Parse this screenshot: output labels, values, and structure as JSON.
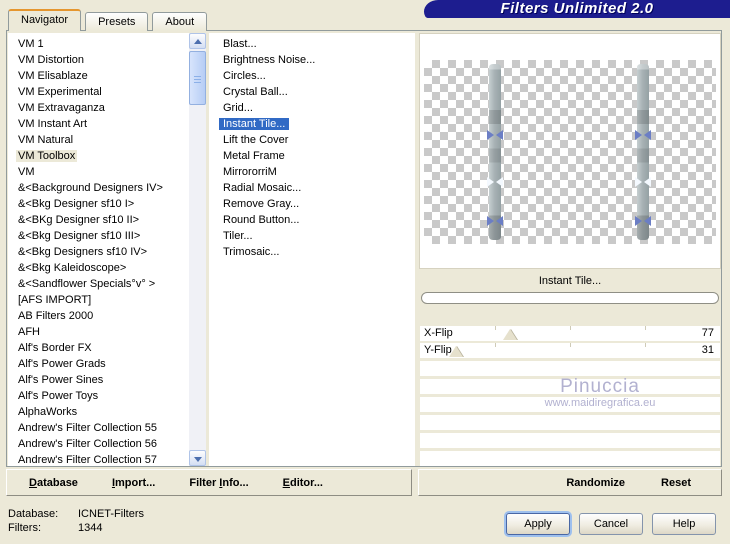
{
  "window": {
    "title": "Filters Unlimited 2.0"
  },
  "tabs": {
    "items": [
      {
        "label": "Navigator",
        "selected": true
      },
      {
        "label": "Presets"
      },
      {
        "label": "About"
      }
    ]
  },
  "categories": {
    "selected_index": 7,
    "items": [
      "VM 1",
      "VM Distortion",
      "VM Elisablaze",
      "VM Experimental",
      "VM Extravaganza",
      "VM Instant Art",
      "VM Natural",
      "VM Toolbox",
      "VM",
      "&<Background Designers IV>",
      "&<Bkg Designer sf10 I>",
      "&<BKg Designer sf10 II>",
      "&<Bkg Designer sf10 III>",
      "&<Bkg Designers sf10 IV>",
      "&<Bkg Kaleidoscope>",
      "&<Sandflower Specials°v° >",
      "[AFS IMPORT]",
      "AB Filters 2000",
      "AFH",
      "Alf's Border FX",
      "Alf's Power Grads",
      "Alf's Power Sines",
      "Alf's Power Toys",
      "AlphaWorks",
      "Andrew's Filter Collection 55",
      "Andrew's Filter Collection 56",
      "Andrew's Filter Collection 57"
    ]
  },
  "filters": {
    "selected_index": 5,
    "items": [
      "Blast...",
      "Brightness Noise...",
      "Circles...",
      "Crystal Ball...",
      "Grid...",
      "Instant Tile...",
      "Lift the Cover",
      "Metal Frame",
      "MirrororriM",
      "Radial Mosaic...",
      "Remove Gray...",
      "Round Button...",
      "Tiler...",
      "Trimosaic..."
    ]
  },
  "preview": {
    "filter_name": "Instant Tile...",
    "watermark_line1": "Pinuccia",
    "watermark_line2": "www.maidiregrafica.eu"
  },
  "sliders": [
    {
      "label": "X-Flip",
      "value": 77,
      "percent": 30
    },
    {
      "label": "Y-Flip",
      "value": 31,
      "percent": 12
    }
  ],
  "toolbar": {
    "left": [
      {
        "pre": "",
        "key": "D",
        "post": "atabase"
      },
      {
        "pre": "",
        "key": "I",
        "post": "mport..."
      },
      {
        "pre": "Filter ",
        "key": "I",
        "post": "nfo..."
      },
      {
        "pre": "",
        "key": "E",
        "post": "ditor..."
      }
    ],
    "right": [
      "Randomize",
      "Reset"
    ]
  },
  "status": {
    "database_label": "Database:",
    "database_value": "ICNET-Filters",
    "filters_label": "Filters:",
    "filters_value": "1344"
  },
  "action_buttons": [
    {
      "label": "Apply",
      "selected": true
    },
    {
      "label": "Cancel"
    },
    {
      "label": "Help"
    }
  ],
  "colors": {
    "dialog_bg": "#ece9d8",
    "title_bar_bg": "#1d1d8f",
    "title_text": "#ffffff",
    "selection_bg": "#316ac5",
    "selection_text": "#ffffff",
    "active_tab_accent": "#e5962e",
    "watermark": "#b2b1d0",
    "list_bg": "#ffffff",
    "checker_gray": "#c9c9c9"
  }
}
